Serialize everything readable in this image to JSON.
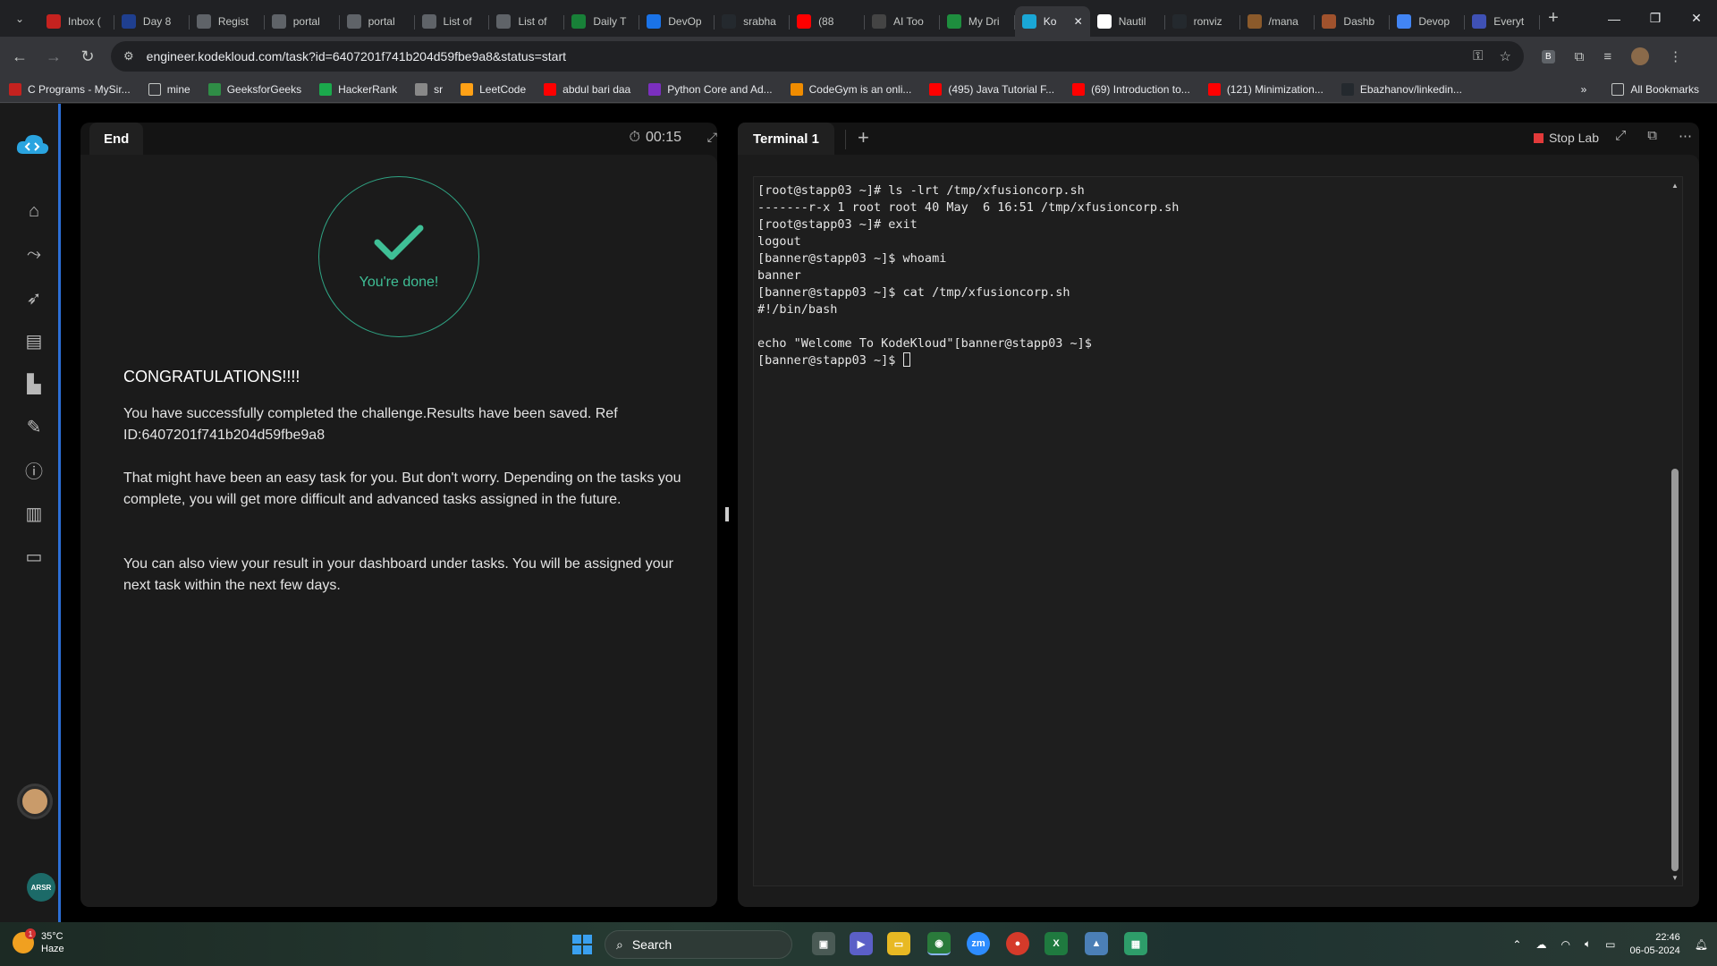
{
  "browser": {
    "tabs": [
      {
        "label": "Inbox (",
        "color": "#c5221f",
        "icon": "gmail-icon"
      },
      {
        "label": "Day 8",
        "color": "#1f3f8f",
        "icon": "doc-icon"
      },
      {
        "label": "Regist",
        "color": "#5f6368",
        "icon": "globe-icon"
      },
      {
        "label": "portal",
        "color": "#5f6368",
        "icon": "globe-icon"
      },
      {
        "label": "portal",
        "color": "#5f6368",
        "icon": "globe-icon"
      },
      {
        "label": "List of",
        "color": "#5f6368",
        "icon": "globe-icon"
      },
      {
        "label": "List of",
        "color": "#5f6368",
        "icon": "globe-icon"
      },
      {
        "label": "Daily T",
        "color": "#188038",
        "icon": "sheets-icon"
      },
      {
        "label": "DevOp",
        "color": "#1a73e8",
        "icon": "devops-icon"
      },
      {
        "label": "srabha",
        "color": "#24292e",
        "icon": "github-icon"
      },
      {
        "label": "(88",
        "color": "#ff0000",
        "icon": "youtube-icon"
      },
      {
        "label": "AI Too",
        "color": "#444",
        "icon": "ai-icon"
      },
      {
        "label": "My Dri",
        "color": "#1e8e3e",
        "icon": "drive-icon"
      },
      {
        "label": "Ko",
        "color": "#1aa7d6",
        "icon": "kodekloud-icon",
        "active": true
      },
      {
        "label": "Nautil",
        "color": "#ffffff",
        "icon": "page-icon"
      },
      {
        "label": "ronviz",
        "color": "#24292e",
        "icon": "github-icon"
      },
      {
        "label": "/mana",
        "color": "#8b5a2b",
        "icon": "page-icon"
      },
      {
        "label": "Dashb",
        "color": "#a0522d",
        "icon": "dashboard-icon"
      },
      {
        "label": "Devop",
        "color": "#4285f4",
        "icon": "docs-icon"
      },
      {
        "label": "Everyt",
        "color": "#3f51b5",
        "icon": "page-icon"
      }
    ],
    "url": "engineer.kodekloud.com/task?id=6407201f741b204d59fbe9a8&status=start",
    "bookmarks": [
      {
        "label": "C Programs - MySir...",
        "color": "#c5221f"
      },
      {
        "label": "mine",
        "color": "folder"
      },
      {
        "label": "GeeksforGeeks",
        "color": "#2f8d46"
      },
      {
        "label": "HackerRank",
        "color": "#1ba94c"
      },
      {
        "label": "sr",
        "color": "#888"
      },
      {
        "label": "LeetCode",
        "color": "#ffa116"
      },
      {
        "label": "abdul bari daa",
        "color": "#ff0000"
      },
      {
        "label": "Python Core and Ad...",
        "color": "#7b2fbf"
      },
      {
        "label": "CodeGym is an onli...",
        "color": "#f08c00"
      },
      {
        "label": "(495) Java Tutorial F...",
        "color": "#ff0000"
      },
      {
        "label": "(69) Introduction to...",
        "color": "#ff0000"
      },
      {
        "label": "(121) Minimization...",
        "color": "#ff0000"
      },
      {
        "label": "Ebazhanov/linkedin...",
        "color": "#24292e"
      }
    ],
    "all_bookmarks": "All Bookmarks"
  },
  "left_panel": {
    "tab_label": "End",
    "timer": "00:15",
    "done_text": "You're done!",
    "congrats": "CONGRATULATIONS!!!!",
    "para1": "You have successfully completed the challenge.Results have been saved. Ref ID:6407201f741b204d59fbe9a8",
    "para2": "That might have been an easy task for you. But don't worry. Depending on the tasks you complete, you will get more difficult and advanced tasks assigned in the future.",
    "para3": "You can also view your result in your dashboard under tasks. You will be assigned your next task within the next few days."
  },
  "right_panel": {
    "tab_label": "Terminal 1",
    "stop_lab": "Stop Lab",
    "terminal_lines": [
      "[root@stapp03 ~]# ls -lrt /tmp/xfusioncorp.sh",
      "-------r-x 1 root root 40 May  6 16:51 /tmp/xfusioncorp.sh",
      "[root@stapp03 ~]# exit",
      "logout",
      "[banner@stapp03 ~]$ whoami",
      "banner",
      "[banner@stapp03 ~]$ cat /tmp/xfusioncorp.sh",
      "#!/bin/bash",
      "",
      "echo \"Welcome To KodeKloud\"[banner@stapp03 ~]$",
      "[banner@stapp03 ~]$ "
    ]
  },
  "sidebar": {
    "user_initials": "ARSR"
  },
  "taskbar": {
    "temperature": "35°C",
    "weather": "Haze",
    "weather_badge": "1",
    "search_placeholder": "Search",
    "time": "22:46",
    "date": "06-05-2024"
  }
}
